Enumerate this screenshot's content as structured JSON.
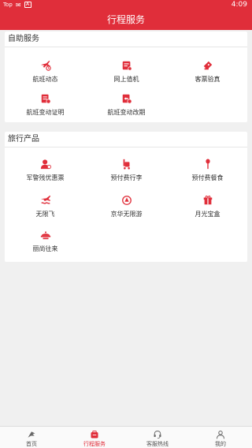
{
  "status_bar": {
    "carrier": "Top",
    "time": "4:09"
  },
  "header": {
    "title": "行程服务"
  },
  "self_service": {
    "title": "自助服务",
    "items": [
      {
        "label": "航班动态",
        "icon": "plane-clock-icon"
      },
      {
        "label": "网上值机",
        "icon": "checkin-icon"
      },
      {
        "label": "客票验真",
        "icon": "ticket-verify-icon"
      },
      {
        "label": "航班变动证明",
        "icon": "change-certificate-icon"
      },
      {
        "label": "航班变动改期",
        "icon": "reschedule-icon"
      }
    ]
  },
  "travel_products": {
    "title": "旅行产品",
    "items": [
      {
        "label": "军警残优惠票",
        "icon": "discount-ticket-icon"
      },
      {
        "label": "预付费行李",
        "icon": "luggage-icon"
      },
      {
        "label": "预付费餐食",
        "icon": "meal-icon"
      },
      {
        "label": "无限飞",
        "icon": "unlimited-fly-icon"
      },
      {
        "label": "京华无限游",
        "icon": "unlimited-tour-icon"
      },
      {
        "label": "月光宝盒",
        "icon": "gift-box-icon"
      },
      {
        "label": "丽尚往来",
        "icon": "lishang-icon"
      }
    ]
  },
  "tab_bar": {
    "tabs": [
      {
        "label": "首页",
        "icon": "home-logo-icon"
      },
      {
        "label": "行程服务",
        "icon": "itinerary-icon",
        "active": true
      },
      {
        "label": "客服热线",
        "icon": "headset-icon"
      },
      {
        "label": "我的",
        "icon": "user-icon"
      }
    ]
  },
  "colors": {
    "accent": "#e02e3a",
    "background": "#f0f0f0"
  }
}
